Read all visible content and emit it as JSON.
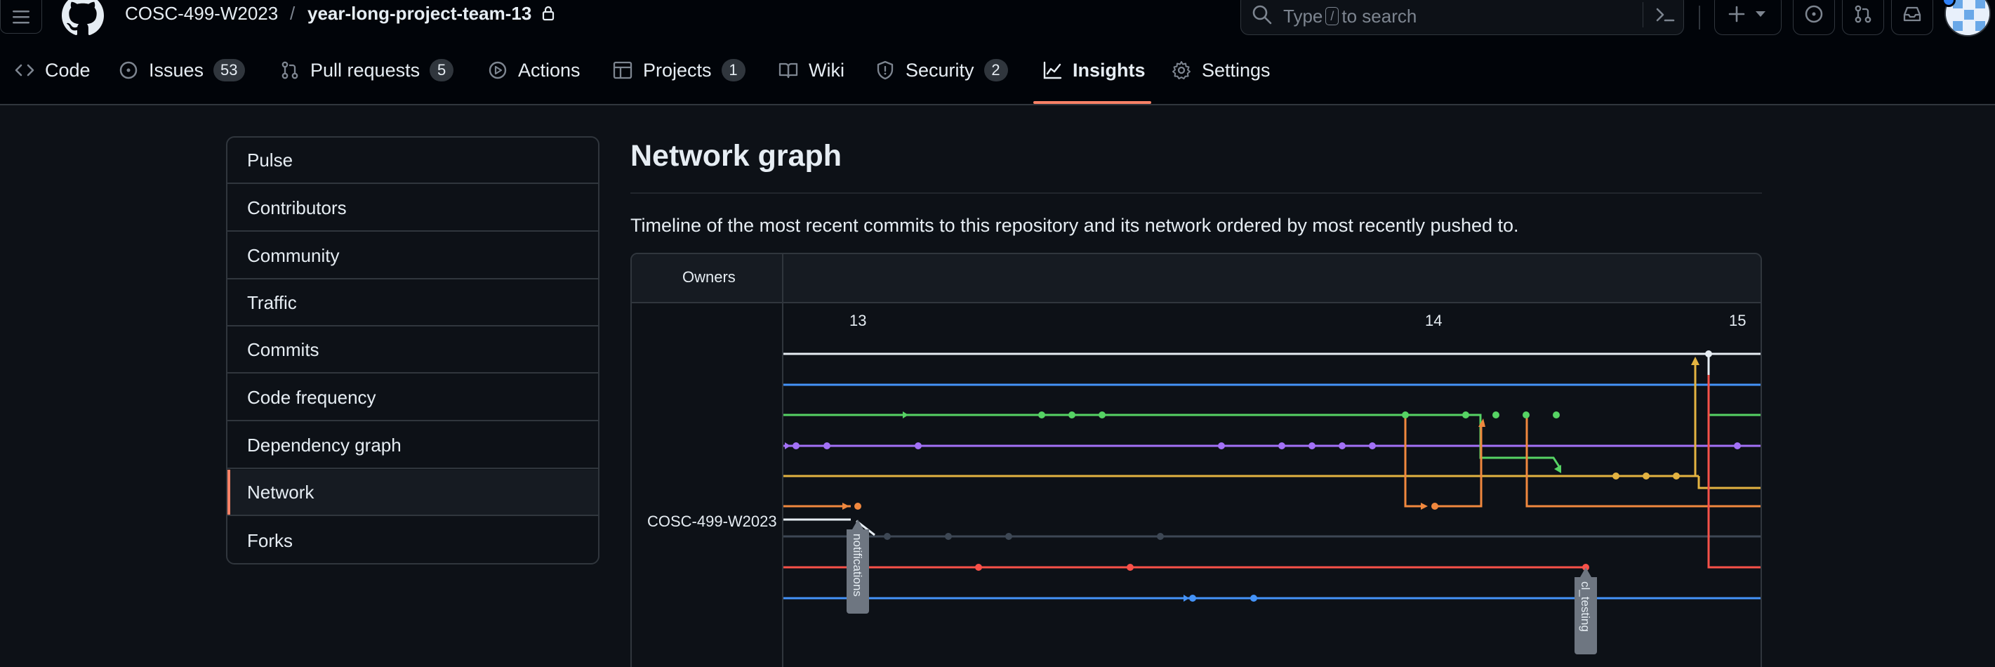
{
  "header": {
    "owner": "COSC-499-W2023",
    "separator": "/",
    "repo": "year-long-project-team-13",
    "search_placeholder_before": "Type",
    "search_key": "/",
    "search_placeholder_after": "to search"
  },
  "tabs": [
    {
      "label": "Code",
      "icon": "code-icon"
    },
    {
      "label": "Issues",
      "count": "53",
      "icon": "issue-opened-icon"
    },
    {
      "label": "Pull requests",
      "count": "5",
      "icon": "git-pull-request-icon"
    },
    {
      "label": "Actions",
      "icon": "play-icon"
    },
    {
      "label": "Projects",
      "count": "1",
      "icon": "table-icon"
    },
    {
      "label": "Wiki",
      "icon": "book-icon"
    },
    {
      "label": "Security",
      "count": "2",
      "icon": "shield-icon"
    },
    {
      "label": "Insights",
      "icon": "graph-icon",
      "active": true
    },
    {
      "label": "Settings",
      "icon": "gear-icon"
    }
  ],
  "sidenav": [
    {
      "label": "Pulse"
    },
    {
      "label": "Contributors"
    },
    {
      "label": "Community"
    },
    {
      "label": "Traffic"
    },
    {
      "label": "Commits"
    },
    {
      "label": "Code frequency"
    },
    {
      "label": "Dependency graph"
    },
    {
      "label": "Network",
      "active": true
    },
    {
      "label": "Forks"
    }
  ],
  "main": {
    "title": "Network graph",
    "description": "Timeline of the most recent commits to this repository and its network ordered by most recently pushed to.",
    "owners_label": "Owners",
    "owner_name": "COSC-499-W2023",
    "dates": [
      "13",
      "14",
      "15"
    ],
    "branch_tags": [
      "notifications",
      "cl_testing"
    ]
  },
  "colors": {
    "accent": "#f78166",
    "white": "#e6edf3",
    "blue": "#4493f8",
    "green": "#56d364",
    "purple": "#a371f7",
    "yellow": "#e3b341",
    "orange": "#f0883e",
    "slate": "#3d4754",
    "red": "#f85149"
  }
}
